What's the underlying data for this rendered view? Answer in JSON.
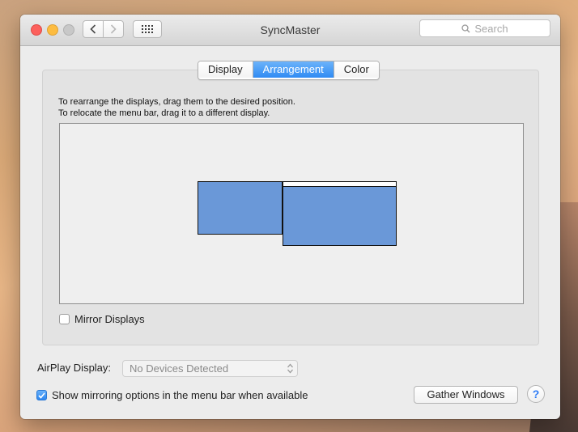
{
  "window": {
    "title": "SyncMaster",
    "search_placeholder": "Search"
  },
  "toolbar": {
    "back_icon": "chevron-left-icon",
    "forward_icon": "chevron-right-icon",
    "show_all_icon": "grid-icon"
  },
  "tabs": [
    {
      "label": "Display",
      "active": false
    },
    {
      "label": "Arrangement",
      "active": true
    },
    {
      "label": "Color",
      "active": false
    }
  ],
  "arrangement": {
    "instruction_line1": "To rearrange the displays, drag them to the desired position.",
    "instruction_line2": "To relocate the menu bar, drag it to a different display.",
    "display_color": "#6a98d8",
    "mirror_displays_label": "Mirror Displays",
    "mirror_displays_checked": false
  },
  "airplay": {
    "label": "AirPlay Display:",
    "selected_value": "No Devices Detected"
  },
  "footer": {
    "show_mirroring_label": "Show mirroring options in the menu bar when available",
    "show_mirroring_checked": true,
    "gather_windows_label": "Gather Windows",
    "help_label": "?"
  },
  "colors": {
    "accent": "#2f8bf3",
    "close": "#fc605c",
    "minimize": "#fdbc40",
    "zoom_disabled": "#c8c8c8"
  }
}
